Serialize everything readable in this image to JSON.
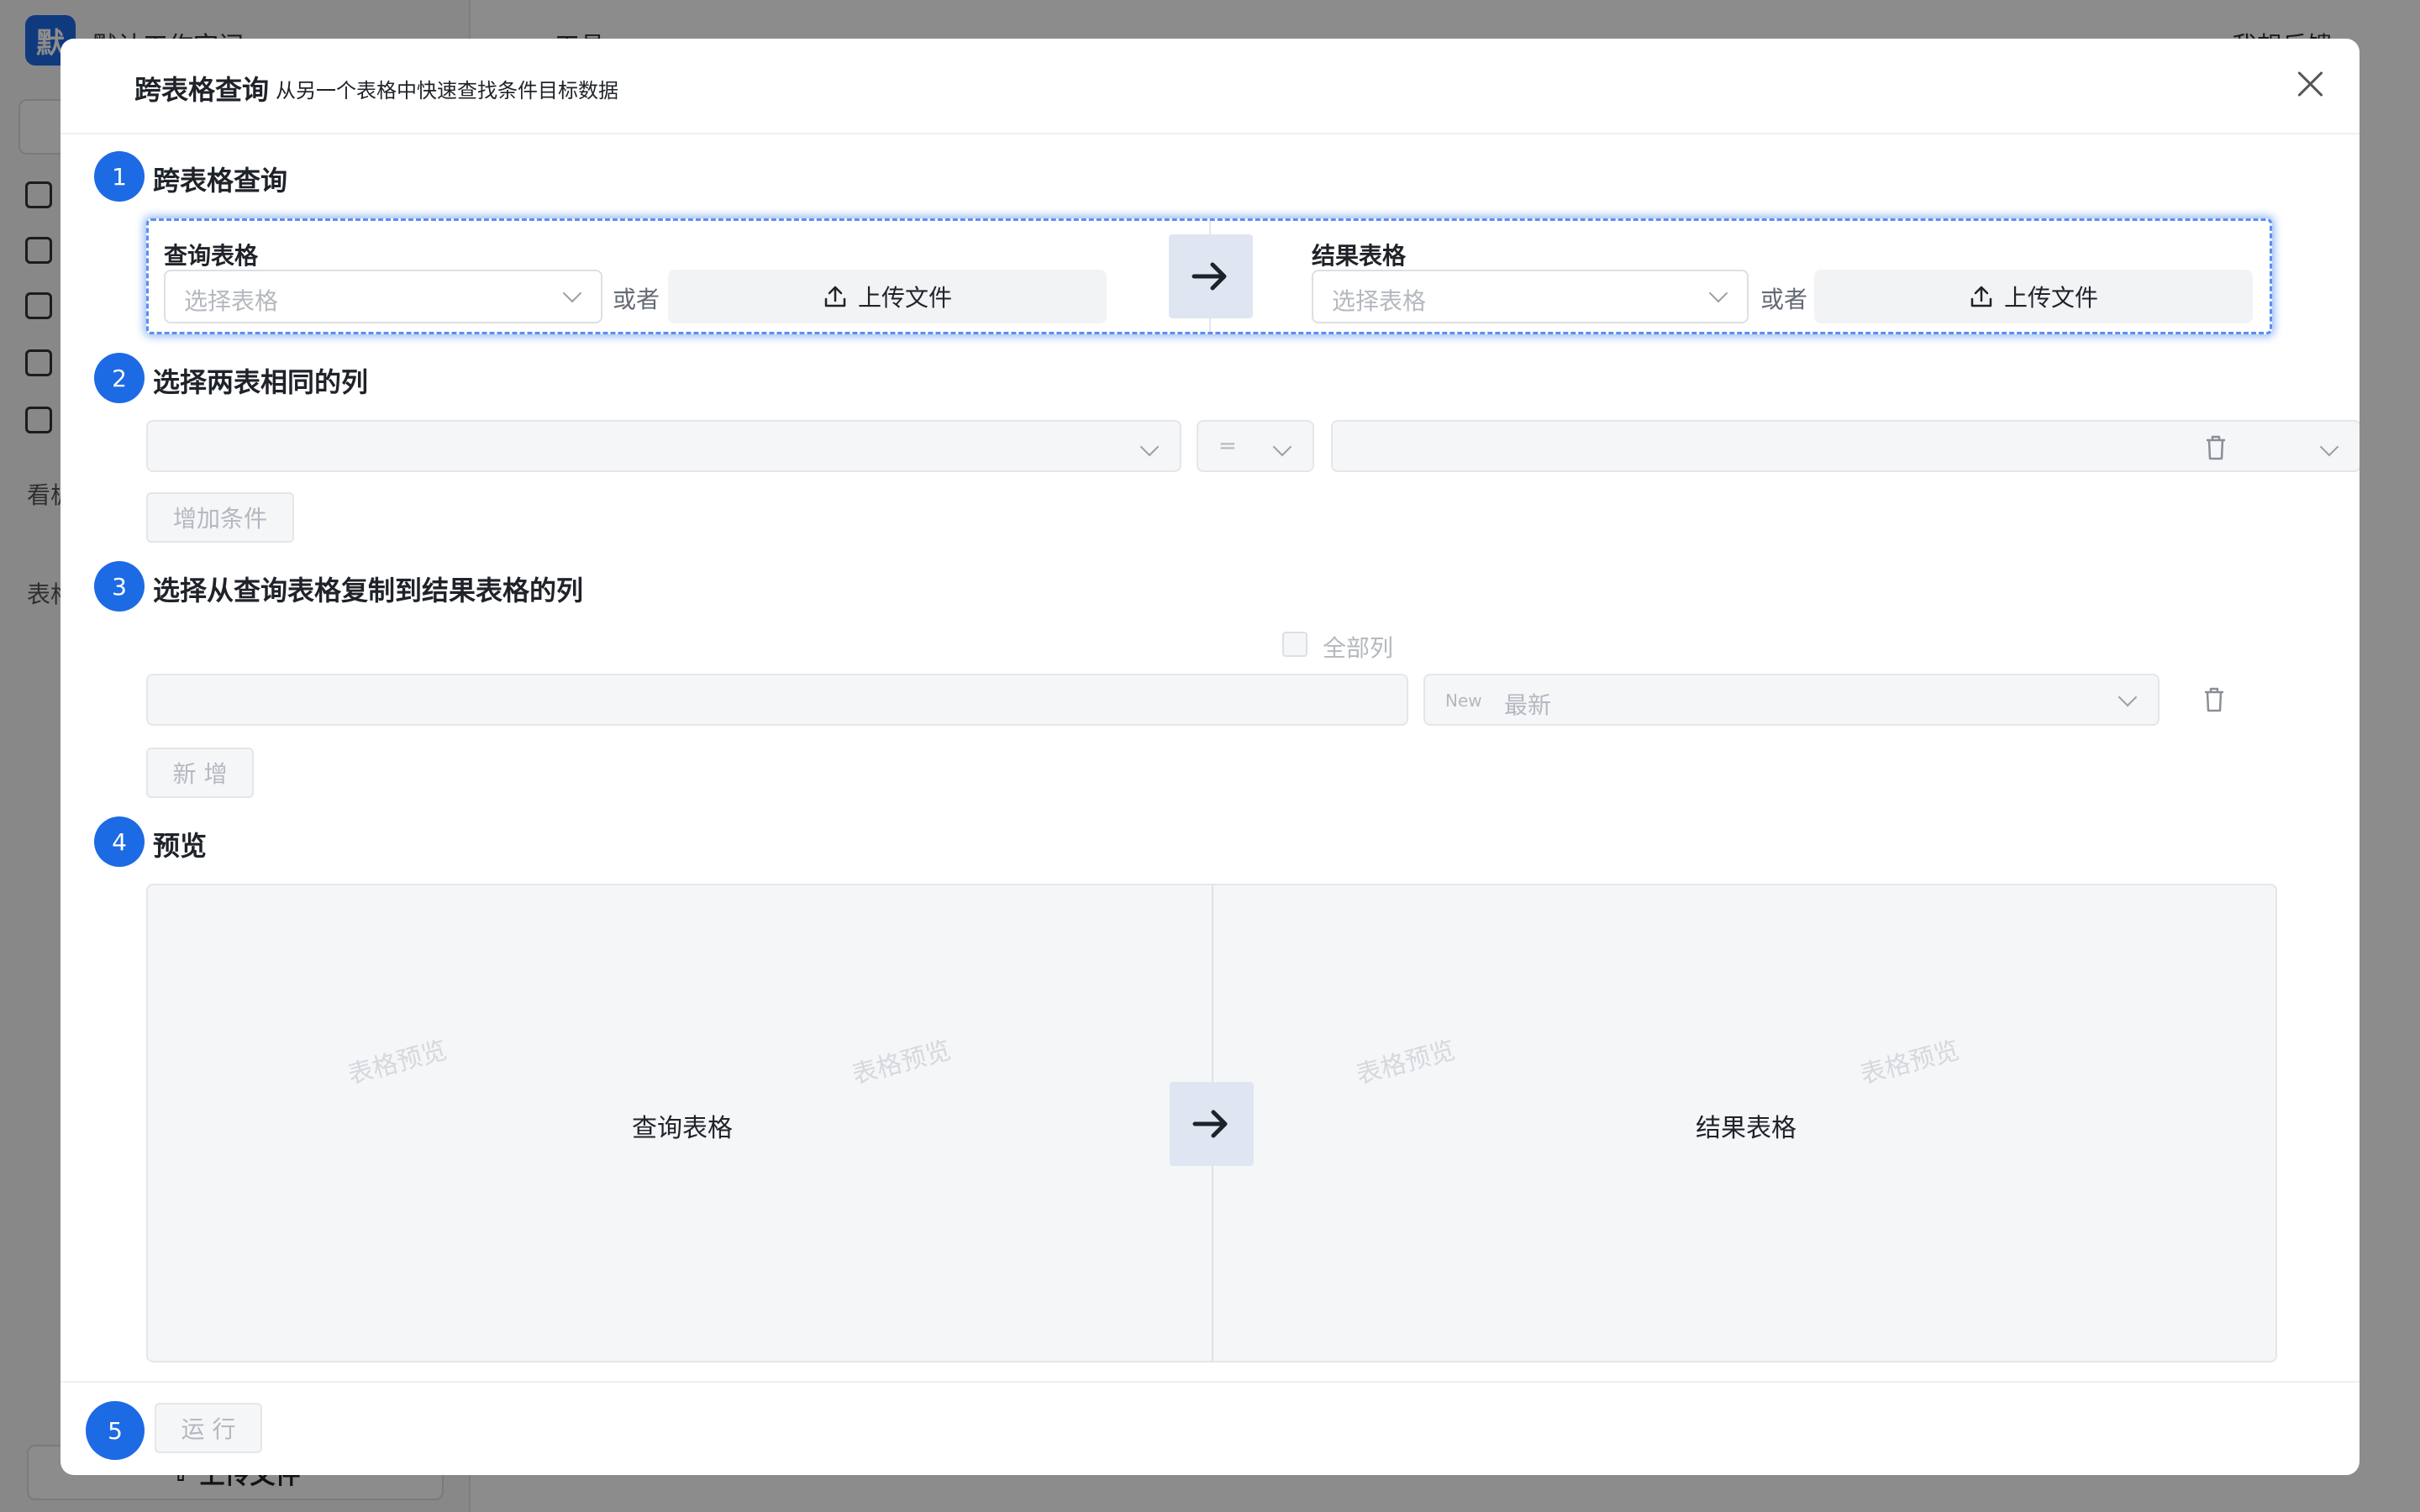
{
  "background": {
    "logo_char": "默",
    "workspace_title": "默认工作空间",
    "header_tools": "工具",
    "header_feedback": "我想反馈",
    "section_board": "看板",
    "section_table": "表格",
    "upload_label": "上传文件"
  },
  "modal": {
    "title": "跨表格查询",
    "subtitle": "从另一个表格中快速查找条件目标数据",
    "close_icon": "close-icon"
  },
  "step1": {
    "number": "1",
    "title": "跨表格查询",
    "query_label": "查询表格",
    "result_label": "结果表格",
    "select_placeholder": "选择表格",
    "or_text": "或者",
    "upload_label": "上传文件"
  },
  "step2": {
    "number": "2",
    "title": "选择两表相同的列",
    "operator": "=",
    "add_condition": "增加条件"
  },
  "step3": {
    "number": "3",
    "title": "选择从查询表格复制到结果表格的列",
    "all_columns": "全部列",
    "new_tag": "New",
    "new_label": "最新",
    "add_button": "新 增"
  },
  "step4": {
    "number": "4",
    "title": "预览",
    "watermark": "表格预览",
    "query_label": "查询表格",
    "result_label": "结果表格"
  },
  "step5": {
    "number": "5",
    "run_button": "运 行"
  },
  "colors": {
    "accent": "#1d6ae5",
    "focus_border": "#5b8ef0",
    "disabled_bg": "#f5f6f8",
    "arrow_bg": "#dfe6f1"
  }
}
